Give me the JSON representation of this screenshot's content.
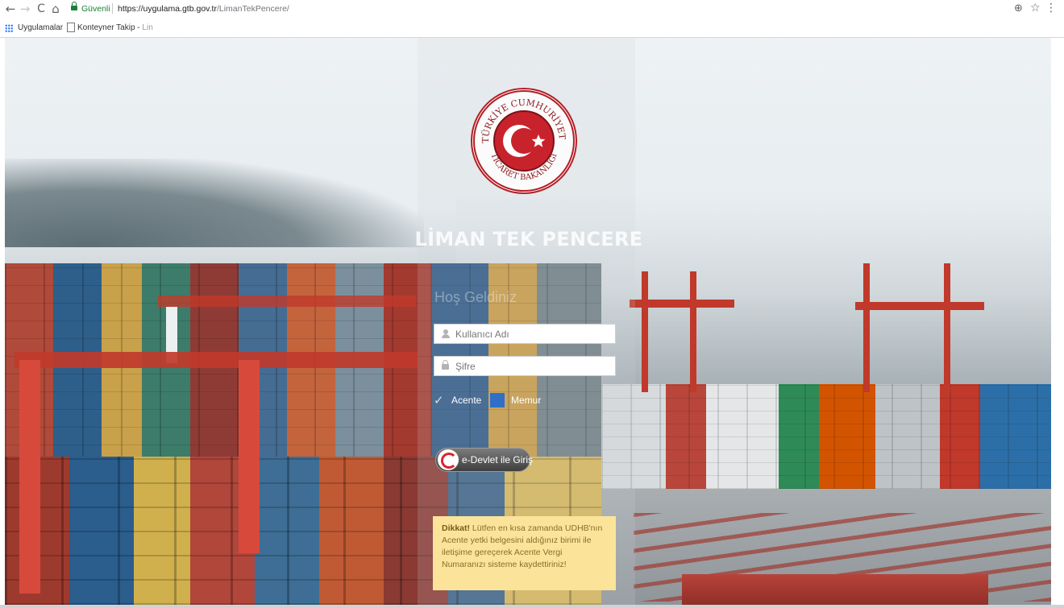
{
  "browser": {
    "secure_label": "Güvenli",
    "url_host": "https://uygulama.gtb.gov.tr",
    "url_path": "/LimanTekPencere/",
    "bookmarks": [
      {
        "label": "Uygulamalar"
      },
      {
        "label": "Konteyner Takip - ",
        "fade": "Lin"
      }
    ],
    "icons": {
      "back": "arrow-left-icon",
      "forward": "arrow-right-icon",
      "reload": "reload-icon",
      "home": "home-icon",
      "zoom": "zoom-icon",
      "bookmark": "star-icon",
      "menu": "kebab-menu-icon"
    }
  },
  "logo": {
    "top_text": "TÜRKİYE CUMHURİYETİ",
    "bottom_text": "TİCARET BAKANLIĞI",
    "colors": {
      "red": "#b41e26",
      "white": "#ffffff"
    }
  },
  "login": {
    "title": "LİMAN TEK PENCERE",
    "welcome": "Hoş Geldiniz",
    "username_placeholder": "Kullanıcı Adı",
    "password_placeholder": "Şifre",
    "roles": [
      {
        "label": "Acente",
        "selected": true
      },
      {
        "label": "Memur",
        "selected": false
      }
    ],
    "edevlet_label": "e-Devlet ile Giriş"
  },
  "notice": {
    "bold": "Dikkat!",
    "text": " Lütfen en kısa zamanda UDHB'nın Acente yetki belgesini aldığınız birimi ile iletişime gereçerek Acente Vergi Numaranızı sisteme kaydettiriniz!",
    "background": "#fbe49a"
  }
}
